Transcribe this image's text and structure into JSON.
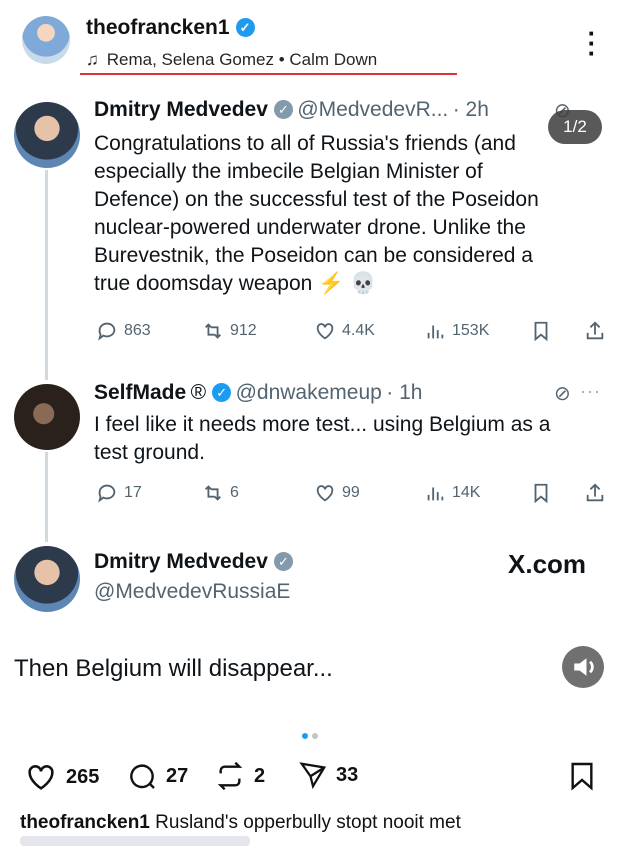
{
  "post": {
    "username": "theofrancken1",
    "music": "Rema, Selena Gomez • Calm Down",
    "slide_indicator": "1/2",
    "likes": "265",
    "comments": "27",
    "reposts": "2",
    "shares": "33",
    "caption_user": "theofrancken1",
    "caption_text": "Rusland's opperbully stopt nooit met"
  },
  "tweet1": {
    "name": "Dmitry Medvedev",
    "handle": "@MedvedevR...",
    "time": "· 2h",
    "text_lines": [
      "Congratulations to all of Russia's friends (and",
      "especially the imbecile Belgian Minister of",
      "Defence) on the successful test of the Poseidon",
      "nuclear-powered underwater drone. Unlike the",
      "Burevestnik, the Poseidon can be considered a",
      "true doomsday weapon ⚡ 💀"
    ],
    "replies": "863",
    "retweets": "912",
    "likes": "4.4K",
    "views": "153K"
  },
  "tweet2": {
    "name": "SelfMade",
    "registered": "®",
    "handle": "@dnwakemeup",
    "time": "· 1h",
    "text_lines": [
      "I feel like it needs more test... using Belgium as a",
      "test ground."
    ],
    "replies": "17",
    "retweets": "6",
    "likes": "99",
    "views": "14K"
  },
  "tweet3": {
    "name": "Dmitry Medvedev",
    "handle": "@MedvedevRussiaE",
    "brand": "X.com",
    "text": "Then Belgium will disappear..."
  },
  "colors": {
    "verified_blue": "#1d9bf0",
    "verified_gray": "#829aab",
    "underline_red": "#e0303a",
    "dot_active": "#1d9bf0",
    "dot_inactive": "#c4c4c4"
  },
  "icons": [
    "music-note-icon",
    "kebab-menu-icon",
    "reply-icon",
    "retweet-icon",
    "like-icon",
    "views-icon",
    "bookmark-icon",
    "share-icon",
    "grok-icon",
    "speaker-icon",
    "heart-icon",
    "comment-icon",
    "repost-icon",
    "send-icon",
    "save-icon"
  ]
}
